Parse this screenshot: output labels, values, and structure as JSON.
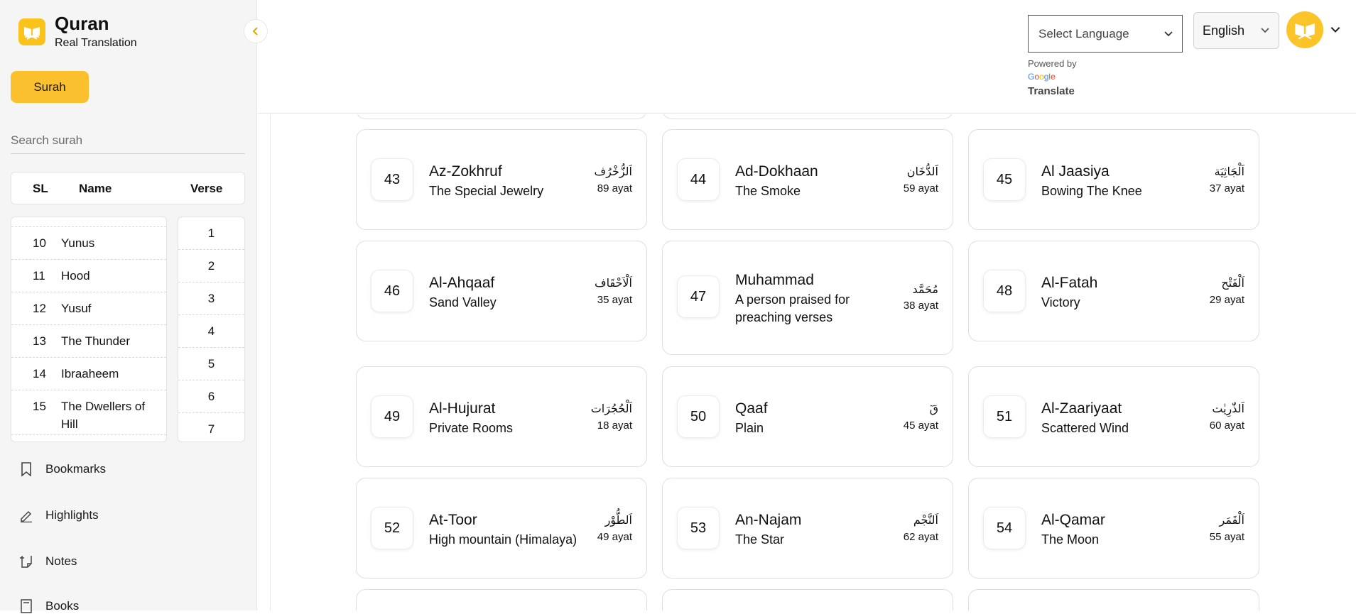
{
  "app": {
    "title": "Quran",
    "subtitle": "Real Translation"
  },
  "sidebar": {
    "surah_button": "Surah",
    "search_placeholder": "Search surah",
    "table_headers": {
      "sl": "SL",
      "name": "Name",
      "verse": "Verse"
    },
    "surahs": [
      {
        "sl": "10",
        "name": "Yunus"
      },
      {
        "sl": "11",
        "name": "Hood"
      },
      {
        "sl": "12",
        "name": "Yusuf"
      },
      {
        "sl": "13",
        "name": "The Thunder"
      },
      {
        "sl": "14",
        "name": "Ibraaheem"
      },
      {
        "sl": "15",
        "name": "The Dwellers of Hill"
      }
    ],
    "verses": [
      "1",
      "2",
      "3",
      "4",
      "5",
      "6",
      "7"
    ],
    "nav": [
      {
        "label": "Bookmarks",
        "icon": "bookmark-icon"
      },
      {
        "label": "Highlights",
        "icon": "pen-icon"
      },
      {
        "label": "Notes",
        "icon": "notes-icon"
      },
      {
        "label": "Books",
        "icon": "book-icon"
      }
    ]
  },
  "header": {
    "language_select_placeholder": "Select Language",
    "powered_by": "Powered by",
    "google": "Google",
    "translate": "Translate",
    "language_button": "English"
  },
  "cards": [
    {
      "number": "43",
      "name": "Az-Zokhruf",
      "translation": "The Special Jewelry",
      "arabic": "اَلزُّخْرُف",
      "ayat": "89 ayat"
    },
    {
      "number": "44",
      "name": "Ad-Dokhaan",
      "translation": "The Smoke",
      "arabic": "اَلدُّخَان",
      "ayat": "59 ayat"
    },
    {
      "number": "45",
      "name": "Al Jaasiya",
      "translation": "Bowing The Knee",
      "arabic": "اَلْجَاثِيَة",
      "ayat": "37 ayat"
    },
    {
      "number": "46",
      "name": "Al-Ahqaaf",
      "translation": "Sand Valley",
      "arabic": "اَلْاَحْقَاف",
      "ayat": "35 ayat"
    },
    {
      "number": "47",
      "name": "Muhammad",
      "translation": "A person praised for preaching verses",
      "arabic": "مُحَمَّد",
      "ayat": "38 ayat"
    },
    {
      "number": "48",
      "name": "Al-Fatah",
      "translation": "Victory",
      "arabic": "اَلْفَتْح",
      "ayat": "29 ayat"
    },
    {
      "number": "49",
      "name": "Al-Hujurat",
      "translation": "Private Rooms",
      "arabic": "اَلْحُجُرَات",
      "ayat": "18 ayat"
    },
    {
      "number": "50",
      "name": "Qaaf",
      "translation": "Plain",
      "arabic": "قٓ",
      "ayat": "45 ayat"
    },
    {
      "number": "51",
      "name": "Al-Zaariyaat",
      "translation": "Scattered Wind",
      "arabic": "اَلذّٰرِيٰت",
      "ayat": "60 ayat"
    },
    {
      "number": "52",
      "name": "At-Toor",
      "translation": "High mountain (Himalaya)",
      "arabic": "اَلطُّوْر",
      "ayat": "49 ayat"
    },
    {
      "number": "53",
      "name": "An-Najam",
      "translation": "The Star",
      "arabic": "اَلنَّجْم",
      "ayat": "62 ayat"
    },
    {
      "number": "54",
      "name": "Al-Qamar",
      "translation": "The Moon",
      "arabic": "اَلْقَمَر",
      "ayat": "55 ayat"
    }
  ],
  "colors": {
    "accent": "#fbc02d",
    "sidebar_bg": "#f5f5f5"
  }
}
